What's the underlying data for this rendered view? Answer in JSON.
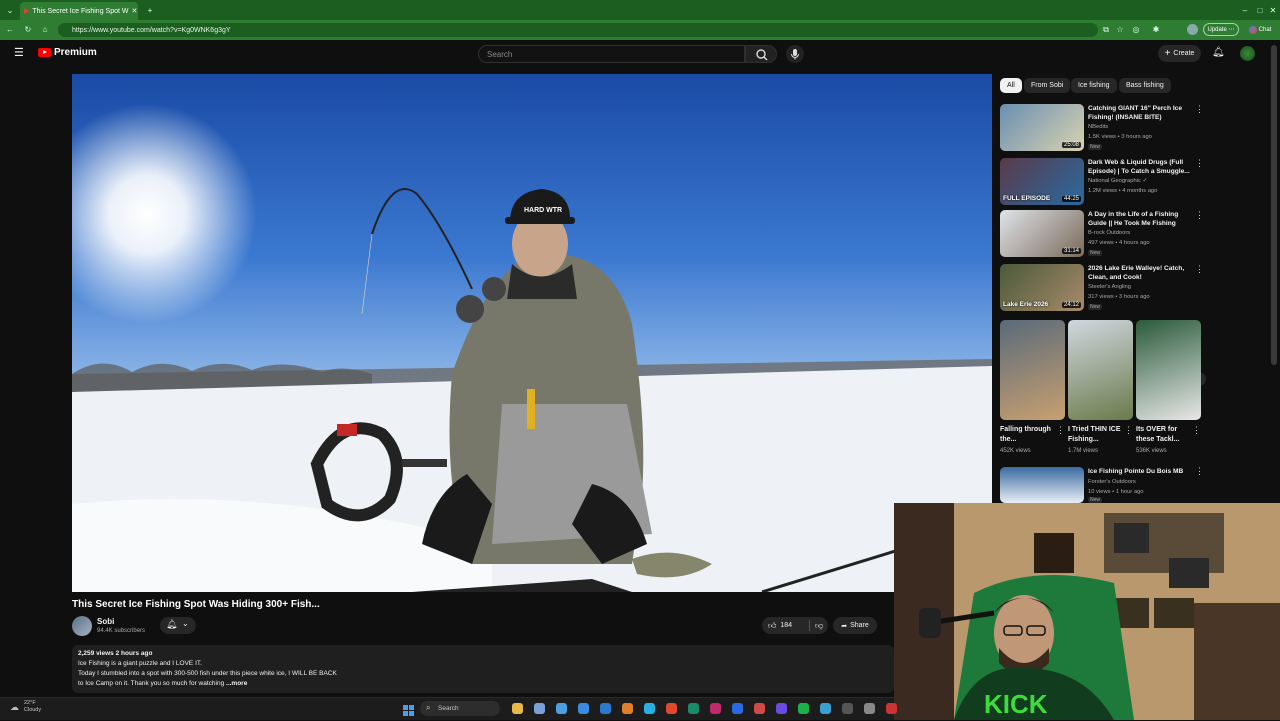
{
  "browser": {
    "tab_title": "This Secret Ice Fishing Spot W",
    "url": "https://www.youtube.com/watch?v=Kg0WNK6g3gY",
    "update_label": "Update",
    "chat_label": "Chat"
  },
  "youtube": {
    "logo_label": "Premium",
    "search_placeholder": "Search",
    "create_label": "Create"
  },
  "video": {
    "title": "This Secret Ice Fishing Spot Was Hiding 300+ Fish...",
    "channel": "Sobi",
    "subscribers": "94.4K subscribers",
    "likes": "184",
    "share_label": "Share",
    "views_date": "2,259 views  2 hours ago",
    "desc_line1": "Ice Fishing is a giant puzzle and I LOVE IT.",
    "desc_line2": "Today I stumbled into a spot with 300-500 fish under this piece white ice, I WILL BE BACK",
    "desc_line3": "to Ice Camp on it. Thank you so much for watching",
    "more_label": "...more",
    "hat_text": "HARD WTR"
  },
  "chips": [
    "All",
    "From Sobi",
    "Ice fishing",
    "Bass fishing"
  ],
  "recommendations": [
    {
      "title": "Catching GIANT 16\" Perch Ice Fishing! (INSANE BITE)",
      "channel": "NBedits",
      "meta": "1.5K views • 3 hours ago",
      "badge": "New",
      "duration": "25:08",
      "c1": "#6a8fb3",
      "c2": "#d8d2b0"
    },
    {
      "title": "Dark Web & Liquid Drugs (Full Episode) | To Catch a Smuggle...",
      "channel": "National Geographic ✓",
      "meta": "1.2M views • 4 months ago",
      "badge": "",
      "duration": "44:25",
      "overlay": "FULL EPISODE",
      "c1": "#5a3a4a",
      "c2": "#2a6aa0"
    },
    {
      "title": "A Day in the Life of a Fishing Guide || He Took Me Fishing",
      "channel": "B-rock Outdoors",
      "meta": "497 views • 4 hours ago",
      "badge": "New",
      "duration": "31:14",
      "c1": "#dfe4ea",
      "c2": "#7b6a5a"
    },
    {
      "title": "2026 Lake Erie Walleye! Catch, Clean, and Cook!",
      "channel": "Steeler's Angling",
      "meta": "317 views • 3 hours ago",
      "badge": "New",
      "duration": "24:12",
      "overlay": "Lake Erie 2026",
      "c1": "#4a5a3a",
      "c2": "#a88a6a"
    }
  ],
  "shorts": [
    {
      "title": "Falling through the...",
      "views": "452K views",
      "c1": "#5a6a7a",
      "c2": "#c8a070"
    },
    {
      "title": "I Tried THIN ICE Fishing...",
      "views": "1.7M views",
      "c1": "#d0d8e0",
      "c2": "#6a7a4a"
    },
    {
      "title": "Its OVER for these Tackl...",
      "views": "536K views",
      "c1": "#2a5a3a",
      "c2": "#e8e8e8"
    }
  ],
  "last_rec": {
    "title": "Ice Fishing Pointe Du Bois MB",
    "channel": "Forster's Outdoors",
    "meta": "10 views • 1 hour ago",
    "badge": "New"
  },
  "taskbar": {
    "temp": "22°F",
    "condition": "Cloudy",
    "search_label": "Search",
    "icons": [
      "#e8b84a",
      "#7aa0d8",
      "#4aa0e0",
      "#3a8ae0",
      "#2a7ad0",
      "#e0802a",
      "#2ab0e0",
      "#e04a2a",
      "#1a8a6a",
      "#c02a6a",
      "#2a6ae0",
      "#d04a4a",
      "#6a4ae0",
      "#1ab04a",
      "#3aa0d0",
      "#555555",
      "#888888",
      "#cc3333"
    ]
  },
  "webcam": {
    "shirt_text": "KICK"
  }
}
